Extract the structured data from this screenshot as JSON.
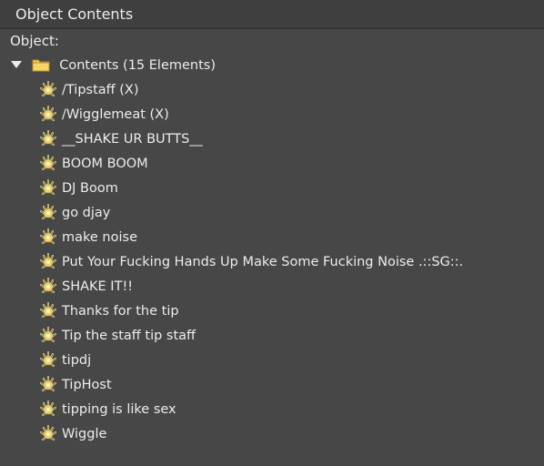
{
  "window": {
    "title": "Object Contents"
  },
  "panel": {
    "object_label": "Object:"
  },
  "tree": {
    "folder": {
      "label": "Contents (15 Elements)",
      "expanded": true,
      "icon": "folder-icon"
    },
    "items": [
      {
        "label": "/Tipstaff (X)",
        "icon": "script-icon"
      },
      {
        "label": "/Wigglemeat (X)",
        "icon": "script-icon"
      },
      {
        "label": "__SHAKE UR BUTTS__",
        "icon": "script-icon"
      },
      {
        "label": "BOOM BOOM",
        "icon": "script-icon"
      },
      {
        "label": "DJ  Boom",
        "icon": "script-icon"
      },
      {
        "label": "go djay",
        "icon": "script-icon"
      },
      {
        "label": "make noise",
        "icon": "script-icon"
      },
      {
        "label": "Put Your Fucking Hands Up Make Some Fucking Noise .::SG::.",
        "icon": "script-icon"
      },
      {
        "label": "SHAKE IT!!",
        "icon": "script-icon"
      },
      {
        "label": "Thanks for the tip",
        "icon": "script-icon"
      },
      {
        "label": "Tip the staff    tip staff",
        "icon": "script-icon"
      },
      {
        "label": "tipdj",
        "icon": "script-icon"
      },
      {
        "label": "TipHost",
        "icon": "script-icon"
      },
      {
        "label": "tipping is like sex",
        "icon": "script-icon"
      },
      {
        "label": "Wiggle",
        "icon": "script-icon"
      }
    ]
  },
  "colors": {
    "background": "#474747",
    "titlebar": "#3f3f3f",
    "text": "#ececec",
    "folder": "#f2c744"
  }
}
